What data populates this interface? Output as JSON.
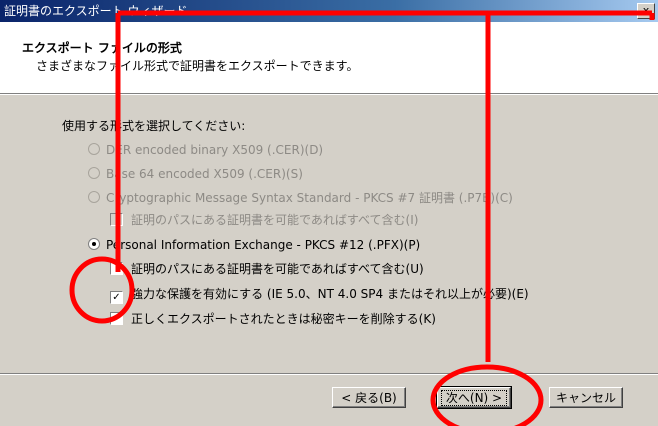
{
  "window": {
    "title": "証明書のエクスポート ウィザード",
    "close_label": "x"
  },
  "header": {
    "title": "エクスポート ファイルの形式",
    "subtitle": "さまざまなファイル形式で証明書をエクスポートできます。"
  },
  "body": {
    "prompt": "使用する形式を選択してください:",
    "options": [
      {
        "label": "DER encoded binary X509 (.CER)(D)",
        "checked": false,
        "enabled": false
      },
      {
        "label": "Base 64 encoded X509 (.CER)(S)",
        "checked": false,
        "enabled": false
      },
      {
        "label": "Cryptographic Message Syntax Standard - PKCS #7 証明書 (.P7B)(C)",
        "checked": false,
        "enabled": false
      },
      {
        "label": "Personal Information Exchange - PKCS #12 (.PFX)(P)",
        "checked": true,
        "enabled": true
      }
    ],
    "p7b_checkbox": {
      "label": "証明のパスにある証明書を可能であればすべて含む(I)",
      "checked": false,
      "enabled": false
    },
    "pfx_checkboxes": [
      {
        "label": "証明のパスにある証明書を可能であればすべて含む(U)",
        "checked": false
      },
      {
        "label": "強力な保護を有効にする (IE 5.0、NT 4.0 SP4 またはそれ以上が必要)(E)",
        "checked": true
      },
      {
        "label": "正しくエクスポートされたときは秘密キーを削除する(K)",
        "checked": false
      }
    ]
  },
  "footer": {
    "back_label": "< 戻る(B)",
    "next_label": "次へ(N) >",
    "cancel_label": "キャンセル"
  },
  "annotation_color": "#ff0000",
  "check_mark": "✓"
}
